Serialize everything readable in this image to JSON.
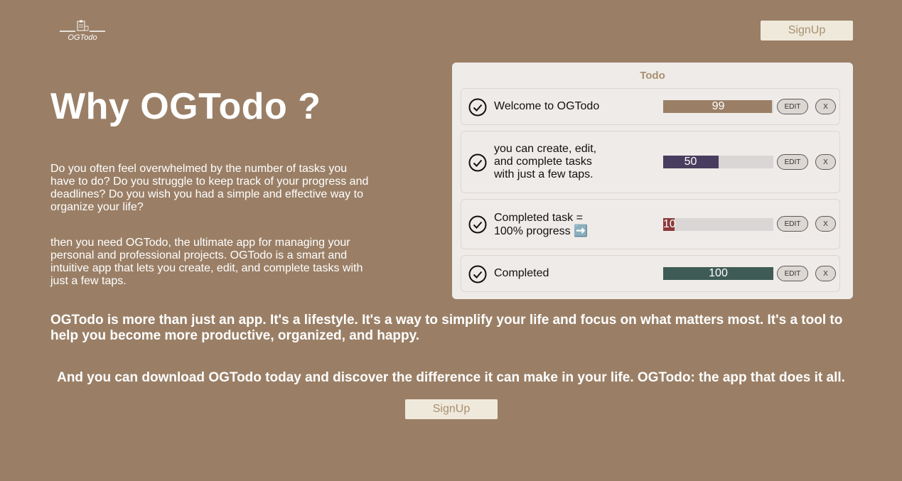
{
  "brand": {
    "logo_text": "OGTodo",
    "logo_icon": "clipboard-icon"
  },
  "header": {
    "signup_label": "SignUp"
  },
  "hero": {
    "title": "Why OGTodo ?",
    "paragraph1": "Do you often feel overwhelmed by the number of tasks you have to do? Do you struggle to keep track of your progress and deadlines? Do you wish you had a simple and effective way to organize your life?",
    "paragraph2": "then you need OGTodo, the ultimate app for managing your personal and professional projects. OGTodo is a smart and intuitive app that lets you create, edit, and complete tasks with just a few taps."
  },
  "todo": {
    "title": "Todo",
    "edit_label": "EDIT",
    "delete_label": "X",
    "items": [
      {
        "text": "Welcome to OGTodo",
        "progress": 99,
        "progress_label": "99",
        "color": "#9a7f66"
      },
      {
        "text": "you can create, edit, and complete tasks with just a few taps.",
        "progress": 50,
        "progress_label": "50",
        "color": "#483d5e"
      },
      {
        "text": "Completed task = 100% progress ➡️",
        "progress": 10,
        "progress_label": "10",
        "color": "#8b3a3a"
      },
      {
        "text": "Completed",
        "progress": 100,
        "progress_label": "100",
        "color": "#3f5b55"
      }
    ]
  },
  "footer": {
    "lifestyle_text": "OGTodo is more than just an app. It's a lifestyle. It's a way to simplify your life and focus on what matters most. It's a tool to help you become more productive, organized, and happy.",
    "download_text": "And you can download OGTodo today and discover the difference it can make in your life. OGTodo: the app that does it all.",
    "signup_label": "SignUp"
  }
}
